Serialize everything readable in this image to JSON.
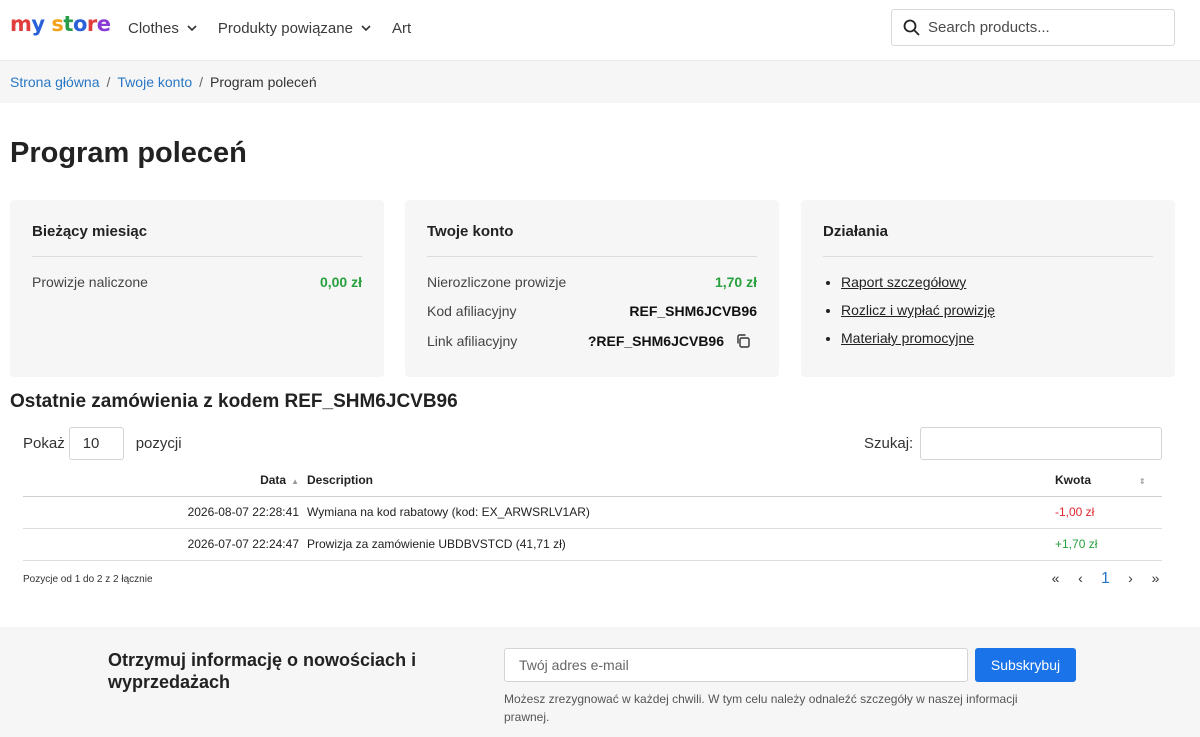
{
  "header": {
    "logo": {
      "letters": [
        "m",
        "y",
        " ",
        "s",
        "t",
        "o",
        "r",
        "e"
      ],
      "colors": [
        "#e23d3d",
        "#2a61d9",
        "#fff",
        "#f2a31b",
        "#2a9d4a",
        "#2a61d9",
        "#e23d3d",
        "#8a3ad6"
      ]
    },
    "nav": [
      {
        "label": "Clothes",
        "has_dropdown": true
      },
      {
        "label": "Produkty powiązane",
        "has_dropdown": true
      },
      {
        "label": "Art",
        "has_dropdown": false
      }
    ],
    "search_placeholder": "Search products..."
  },
  "breadcrumb": {
    "home": "Strona główna",
    "account": "Twoje konto",
    "current": "Program poleceń",
    "separator": "/"
  },
  "page_title": "Program poleceń",
  "cards": {
    "month": {
      "title": "Bieżący miesiąc",
      "label": "Prowizje naliczone",
      "value": "0,00 zł"
    },
    "account": {
      "title": "Twoje konto",
      "unsettled_label": "Nierozliczone prowizje",
      "unsettled_value": "1,70 zł",
      "code_label": "Kod afiliacyjny",
      "code_value": "REF_SHM6JCVB96",
      "link_label": "Link afiliacyjny",
      "link_value": "?REF_SHM6JCVB96"
    },
    "actions": {
      "title": "Działania",
      "links": [
        "Raport szczegółowy",
        "Rozlicz i wypłać prowizję",
        "Materiały promocyjne"
      ]
    }
  },
  "orders": {
    "title": "Ostatnie zamówienia z kodem REF_SHM6JCVB96",
    "show_label": "Pokaż",
    "show_value": "10",
    "show_suffix": "pozycji",
    "search_label": "Szukaj:",
    "columns": {
      "date": "Data",
      "description": "Description",
      "amount": "Kwota"
    },
    "rows": [
      {
        "date": "2026-08-07 22:28:41",
        "description": "Wymiana na kod rabatowy (kod: EX_ARWSRLV1AR)",
        "amount": "-1,00 zł",
        "positive": false
      },
      {
        "date": "2026-07-07 22:24:47",
        "description": "Prowizja za zamówienie UBDBVSTCD (41,71 zł)",
        "amount": "+1,70 zł",
        "positive": true
      }
    ],
    "info": "Pozycje od 1 do 2 z 2 łącznie",
    "pager": {
      "first": "«",
      "prev": "‹",
      "page": "1",
      "next": "›",
      "last": "»"
    }
  },
  "newsletter": {
    "heading": "Otrzymuj informację o nowościach i wyprzedażach",
    "email_placeholder": "Twój adres e-mail",
    "button": "Subskrybuj",
    "note": "Możesz zrezygnować w każdej chwili. W tym celu należy odnaleźć szczegóły w naszej informacji prawnej."
  }
}
